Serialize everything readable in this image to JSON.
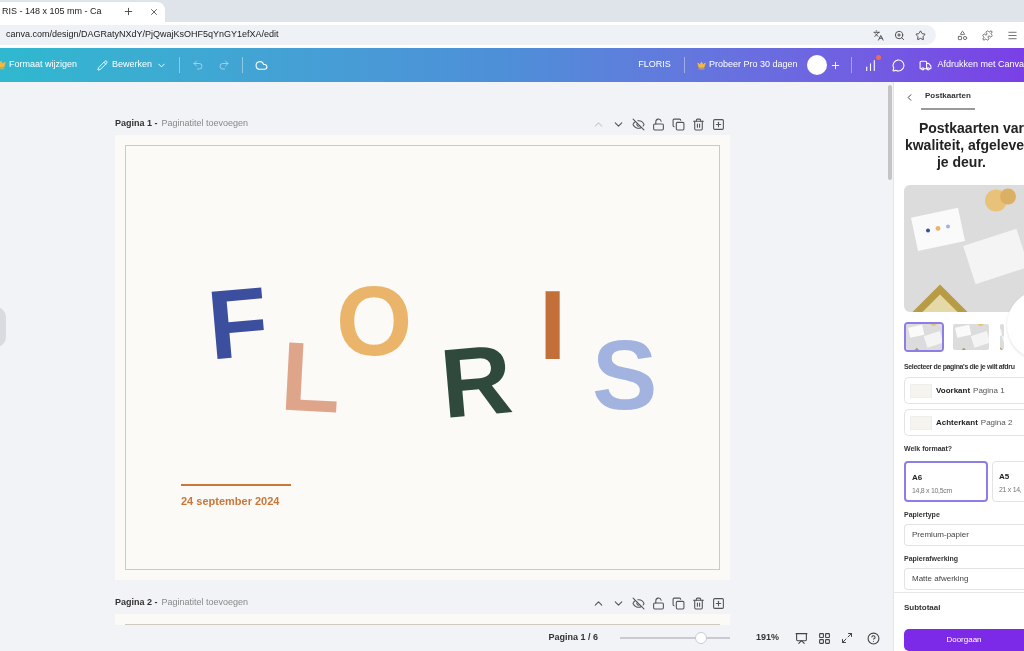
{
  "browser": {
    "tab_title": "RIS - 148 x 105 mm - Ca",
    "url": "canva.com/design/DAGRatyNXdY/PjQwajKsOHF5qYnGY1efXA/edit"
  },
  "toolbar": {
    "resize": "Formaat wijzigen",
    "edit": "Bewerken",
    "design_name": "FLORIS",
    "pro_trial": "Probeer Pro 30 dagen",
    "print": "Afdrukken met Canva"
  },
  "pages": [
    {
      "label": "Pagina 1 -",
      "title_placeholder": "Paginatitel toevoegen",
      "up_disabled": true,
      "letters": [
        {
          "char": "F",
          "color": "#3b4f9e"
        },
        {
          "char": "L",
          "color": "#dfa58a"
        },
        {
          "char": "O",
          "color": "#eab56b"
        },
        {
          "char": "R",
          "color": "#2f4a3d"
        },
        {
          "char": "I",
          "color": "#c36f39"
        },
        {
          "char": "S",
          "color": "#a3b3df"
        }
      ],
      "date": "24 september 2024"
    },
    {
      "label": "Pagina 2 -",
      "title_placeholder": "Paginatitel toevoegen",
      "up_disabled": false
    }
  ],
  "footer": {
    "page_indicator": "Pagina 1 / 6",
    "zoom": {
      "level": 0.74,
      "reading": "191%"
    }
  },
  "panel": {
    "tabs": [
      {
        "label": "Postkaarten",
        "selected": true
      }
    ],
    "heading": [
      "Postkaarten var",
      "kwaliteit, afgeleve",
      "je deur."
    ],
    "thumbnails": [
      {
        "selected": true
      },
      {
        "selected": false
      },
      {
        "selected": false
      }
    ],
    "pages_label": "Selecteer de pagina's die je wilt afdru",
    "sides": [
      {
        "name": "Voorkant",
        "page": "Pagina 1"
      },
      {
        "name": "Achterkant",
        "page": "Pagina 2"
      }
    ],
    "format_label": "Welk formaat?",
    "formats": [
      {
        "name": "A6",
        "size": "14,8 x 10,5cm",
        "selected": true
      },
      {
        "name": "A5",
        "size": "21 x 14,",
        "selected": false
      }
    ],
    "paper_label": "Papiertype",
    "paper": "Premium-papier",
    "finish_label": "Papierafwerking",
    "finish": "Matte afwerking",
    "subtotal": "Subtotaal",
    "continue": "Doorgaan"
  }
}
